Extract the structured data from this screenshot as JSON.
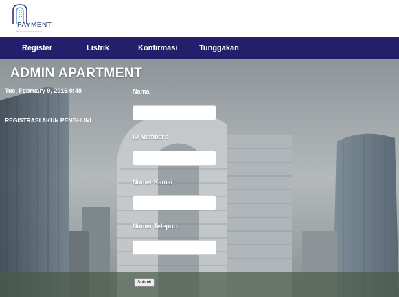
{
  "logo": {
    "name": "PAYMENT",
    "tagline": "We Pay For Your Apartment"
  },
  "nav": {
    "items": [
      {
        "label": "Register"
      },
      {
        "label": "Listrik"
      },
      {
        "label": "Konfirmasi"
      },
      {
        "label": "Tunggakan"
      }
    ]
  },
  "page": {
    "title": "ADMIN APARTMENT",
    "datetime": "Tue, February 9, 2016 0:48",
    "section_label": "REGISTRASI AKUN PENGHUNI"
  },
  "form": {
    "fields": [
      {
        "label": "Nama :",
        "value": ""
      },
      {
        "label": "ID Member :",
        "value": ""
      },
      {
        "label": "Nomer Kamar :",
        "value": ""
      },
      {
        "label": "Nomer Telepon :",
        "value": ""
      }
    ],
    "submit_label": "Submit"
  },
  "colors": {
    "nav_bg": "#241f6b",
    "logo": "#2a3a6e"
  }
}
